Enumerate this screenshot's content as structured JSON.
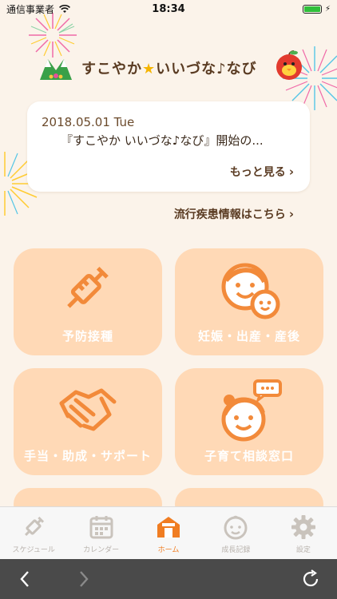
{
  "status": {
    "carrier": "通信事業者",
    "time": "18:34"
  },
  "header": {
    "title_part1": "すこやか",
    "title_star": "★",
    "title_part2": "いいづな♪なび"
  },
  "news": {
    "date": "2018.05.01 Tue",
    "text": "『すこやか いいづな♪なび』開始の...",
    "more_label": "もっと見る"
  },
  "epidemic_link": "流行疾患情報はこちら",
  "tiles": [
    {
      "label": "予防接種",
      "icon": "syringe-icon"
    },
    {
      "label": "妊娠・出産・産後",
      "icon": "mother-child-icon"
    },
    {
      "label": "手当・助成・サポート",
      "icon": "handshake-icon"
    },
    {
      "label": "子育て相談窓口",
      "icon": "consult-icon"
    }
  ],
  "tabs": [
    {
      "label": "スケジュール",
      "icon": "syringe-icon"
    },
    {
      "label": "カレンダー",
      "icon": "calendar-icon"
    },
    {
      "label": "ホーム",
      "icon": "home-icon"
    },
    {
      "label": "成長記録",
      "icon": "face-icon"
    },
    {
      "label": "設定",
      "icon": "gear-icon"
    }
  ],
  "active_tab": "ホーム",
  "colors": {
    "accent": "#f07d22",
    "tile_bg": "#ffd9b6",
    "icon_orange": "#f28a3a",
    "background": "#fbf3ea"
  }
}
